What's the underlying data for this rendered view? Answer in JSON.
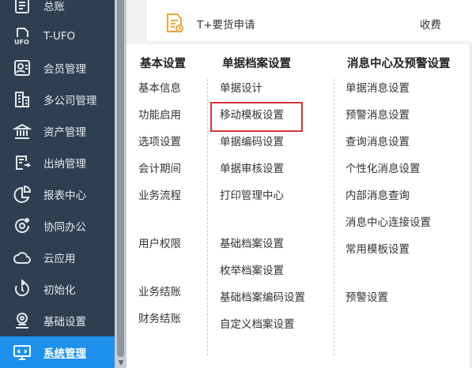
{
  "sidebar": {
    "items": [
      {
        "label": "总账",
        "icon": "ledger-icon"
      },
      {
        "label": "T-UFO",
        "icon": "ufo-report-icon"
      },
      {
        "label": "会员管理",
        "icon": "member-card-icon"
      },
      {
        "label": "多公司管理",
        "icon": "building-icon"
      },
      {
        "label": "资产管理",
        "icon": "bank-icon"
      },
      {
        "label": "出纳管理",
        "icon": "cashier-icon"
      },
      {
        "label": "报表中心",
        "icon": "pie-chart-icon"
      },
      {
        "label": "协同办公",
        "icon": "collaboration-icon"
      },
      {
        "label": "云应用",
        "icon": "cloud-icon"
      },
      {
        "label": "初始化",
        "icon": "refresh-icon"
      },
      {
        "label": "基础设置",
        "icon": "basic-settings-icon"
      },
      {
        "label": "系统管理",
        "icon": "system-settings-icon"
      }
    ],
    "active_index": 11,
    "colors": {
      "background": "#2f3f52",
      "active": "#1e90ee",
      "text": "#e3e8ee"
    }
  },
  "top_card": {
    "title": "T+要货申请",
    "action": "收费",
    "icon": "request-document-icon",
    "icon_color": "#f0a43a"
  },
  "menu": {
    "columns": [
      {
        "heading": "基本设置",
        "items": [
          "基本信息",
          "功能启用",
          "选项设置",
          "会计期间",
          "业务流程",
          "用户权限",
          "业务结账",
          "财务结账"
        ]
      },
      {
        "heading": "单据档案设置",
        "items": [
          "单据设计",
          "移动模板设置",
          "单据编码设置",
          "单据审核设置",
          "打印管理中心",
          "基础档案设置",
          "枚举档案设置",
          "基础档案编码设置",
          "自定义档案设置"
        ]
      },
      {
        "heading": "消息中心及预警设置",
        "items": [
          "单据消息设置",
          "预警消息设置",
          "查询消息设置",
          "个性化消息设置",
          "内部消息查询",
          "消息中心连接设置",
          "常用模板设置",
          "预警设置"
        ]
      }
    ],
    "highlighted_item": "移动模板设置",
    "highlight_color": "#d9353b"
  }
}
